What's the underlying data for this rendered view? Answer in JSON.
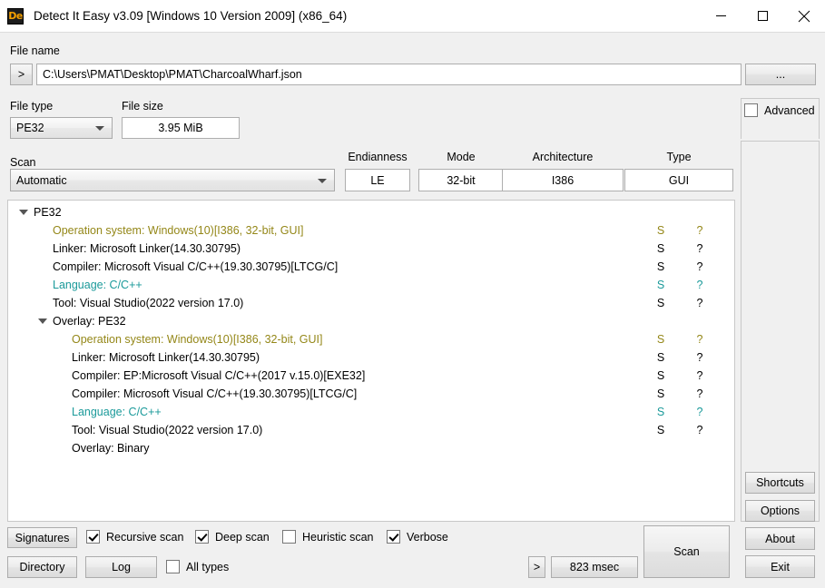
{
  "window": {
    "title": "Detect It Easy v3.09 [Windows 10 Version 2009] (x86_64)",
    "icon_text": "De",
    "minimize_label": "Minimize",
    "maximize_label": "Maximize",
    "close_label": "Close"
  },
  "file_name": {
    "label": "File name",
    "expand_button": ">",
    "value": "C:\\Users\\PMAT\\Desktop\\PMAT\\CharcoalWharf.json",
    "browse_button": "..."
  },
  "file_type": {
    "label": "File type",
    "value": "PE32"
  },
  "file_size": {
    "label": "File size",
    "value": "3.95 MiB"
  },
  "scan": {
    "label": "Scan",
    "value": "Automatic"
  },
  "info_fields": [
    {
      "label": "Endianness",
      "value": "LE"
    },
    {
      "label": "Mode",
      "value": "32-bit"
    },
    {
      "label": "Architecture",
      "value": "I386"
    },
    {
      "label": "Type",
      "value": "GUI"
    }
  ],
  "advanced": {
    "label": "Advanced",
    "checked": false
  },
  "colors": {
    "os": "#948718",
    "normal": "#000000",
    "language": "#1b9a9a",
    "accent": "#f5a000"
  },
  "tree": [
    {
      "indent": 0,
      "arrow": true,
      "text": "PE32",
      "color": "normal",
      "s": "",
      "q": ""
    },
    {
      "indent": 1,
      "arrow": false,
      "text": "Operation system: Windows(10)[I386, 32-bit, GUI]",
      "color": "os",
      "s": "S",
      "q": "?"
    },
    {
      "indent": 1,
      "arrow": false,
      "text": "Linker: Microsoft Linker(14.30.30795)",
      "color": "normal",
      "s": "S",
      "q": "?"
    },
    {
      "indent": 1,
      "arrow": false,
      "text": "Compiler: Microsoft Visual C/C++(19.30.30795)[LTCG/C]",
      "color": "normal",
      "s": "S",
      "q": "?"
    },
    {
      "indent": 1,
      "arrow": false,
      "text": "Language: C/C++",
      "color": "language",
      "s": "S",
      "q": "?"
    },
    {
      "indent": 1,
      "arrow": false,
      "text": "Tool: Visual Studio(2022 version 17.0)",
      "color": "normal",
      "s": "S",
      "q": "?"
    },
    {
      "indent": 1,
      "arrow": true,
      "text": "Overlay: PE32",
      "color": "normal",
      "s": "",
      "q": ""
    },
    {
      "indent": 2,
      "arrow": false,
      "text": "Operation system: Windows(10)[I386, 32-bit, GUI]",
      "color": "os",
      "s": "S",
      "q": "?"
    },
    {
      "indent": 2,
      "arrow": false,
      "text": "Linker: Microsoft Linker(14.30.30795)",
      "color": "normal",
      "s": "S",
      "q": "?"
    },
    {
      "indent": 2,
      "arrow": false,
      "text": "Compiler: EP:Microsoft Visual C/C++(2017 v.15.0)[EXE32]",
      "color": "normal",
      "s": "S",
      "q": "?"
    },
    {
      "indent": 2,
      "arrow": false,
      "text": "Compiler: Microsoft Visual C/C++(19.30.30795)[LTCG/C]",
      "color": "normal",
      "s": "S",
      "q": "?"
    },
    {
      "indent": 2,
      "arrow": false,
      "text": "Language: C/C++",
      "color": "language",
      "s": "S",
      "q": "?"
    },
    {
      "indent": 2,
      "arrow": false,
      "text": "Tool: Visual Studio(2022 version 17.0)",
      "color": "normal",
      "s": "S",
      "q": "?"
    },
    {
      "indent": 2,
      "arrow": false,
      "text": "Overlay: Binary",
      "color": "normal",
      "s": "",
      "q": ""
    }
  ],
  "bottom": {
    "signatures_button": "Signatures",
    "directory_button": "Directory",
    "log_button": "Log",
    "scan_button": "Scan",
    "time_expand_button": ">",
    "time_value": "823 msec",
    "checkboxes": [
      {
        "label": "Recursive scan",
        "checked": true
      },
      {
        "label": "Deep scan",
        "checked": true
      },
      {
        "label": "Heuristic scan",
        "checked": false
      },
      {
        "label": "Verbose",
        "checked": true
      }
    ],
    "all_types": {
      "label": "All types",
      "checked": false
    }
  },
  "rail_buttons": {
    "shortcuts": "Shortcuts",
    "options": "Options",
    "about": "About",
    "exit": "Exit"
  }
}
